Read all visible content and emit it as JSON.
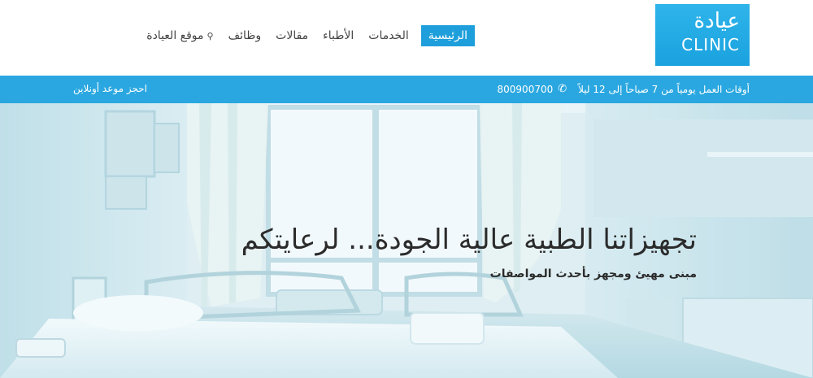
{
  "logo": {
    "arabic": "عيادة",
    "english": "CLINIC"
  },
  "nav": {
    "items": [
      {
        "label": "الرئيسية",
        "active": true
      },
      {
        "label": "الخدمات"
      },
      {
        "label": "الأطباء"
      },
      {
        "label": "مقالات"
      },
      {
        "label": "وظائف"
      },
      {
        "label": "موقع العيادة",
        "icon": "location-pin-icon"
      }
    ]
  },
  "infobar": {
    "hours": "أوقات العمل يومياً من 7 صباحاً إلى 12 ليلاً",
    "phone": "800900700",
    "phone_icon": "phone-icon",
    "booking": "احجز موعد أونلاين"
  },
  "hero": {
    "title": "تجهيزاتنا الطبية عالية الجودة... لرعايتكم",
    "subtitle": "مبنى مهيئ ومجهز بأحدث المواصفات"
  },
  "colors": {
    "brand": "#1e9fdb",
    "infobar": "#2aa7e0",
    "text": "#2b2b2b"
  }
}
